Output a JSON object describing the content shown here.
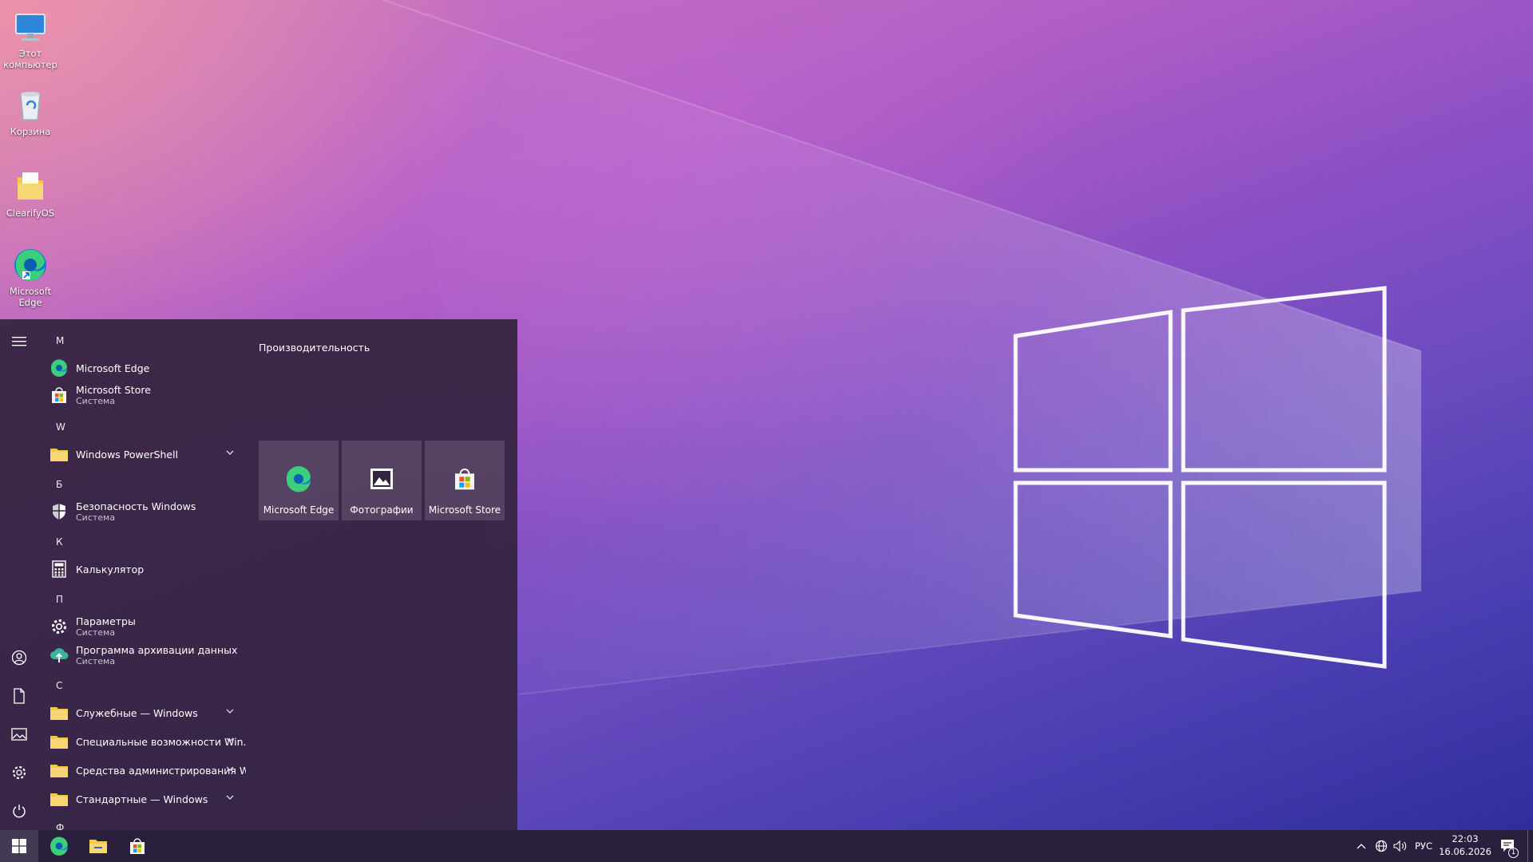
{
  "desktop": {
    "icons": [
      {
        "label": "Этот компьютер",
        "icon": "monitor-icon"
      },
      {
        "label": "Корзина",
        "icon": "recycle-bin-icon"
      },
      {
        "label": "ClearifyOS",
        "icon": "folder-icon"
      },
      {
        "label": "Microsoft Edge",
        "icon": "edge-icon"
      }
    ]
  },
  "start_menu": {
    "rail": [
      "hamburger-icon",
      "user-icon",
      "documents-icon",
      "pictures-icon",
      "settings-icon",
      "power-icon"
    ],
    "sections": {
      "m": "M",
      "w": "W",
      "b": "Б",
      "k": "К",
      "p": "П",
      "s": "С",
      "f": "Ф"
    },
    "apps": [
      {
        "name": "Microsoft Edge",
        "sub": ""
      },
      {
        "name": "Microsoft Store",
        "sub": "Система"
      },
      {
        "name": "Windows PowerShell",
        "sub": ""
      },
      {
        "name": "Безопасность Windows",
        "sub": "Система"
      },
      {
        "name": "Калькулятор",
        "sub": ""
      },
      {
        "name": "Параметры",
        "sub": "Система"
      },
      {
        "name": "Программа архивации данных",
        "sub": "Система"
      },
      {
        "name": "Служебные — Windows",
        "sub": ""
      },
      {
        "name": "Специальные возможности Win...",
        "sub": ""
      },
      {
        "name": "Средства администрирования W...",
        "sub": ""
      },
      {
        "name": "Стандартные — Windows",
        "sub": ""
      }
    ],
    "tiles_group": "Производительность",
    "tiles": [
      {
        "label": "Microsoft Edge"
      },
      {
        "label": "Фотографии"
      },
      {
        "label": "Microsoft Store"
      }
    ]
  },
  "taskbar": {
    "pinned": [
      "windows-start-icon",
      "edge-icon",
      "file-explorer-icon",
      "store-icon"
    ],
    "language": "РУС",
    "time": "22:03",
    "date": "16.06.2026",
    "notifications": "1"
  },
  "colors": {
    "accent": "#7a4fc4",
    "taskbar": "#2a1f3d",
    "start_bg": "#342440"
  }
}
